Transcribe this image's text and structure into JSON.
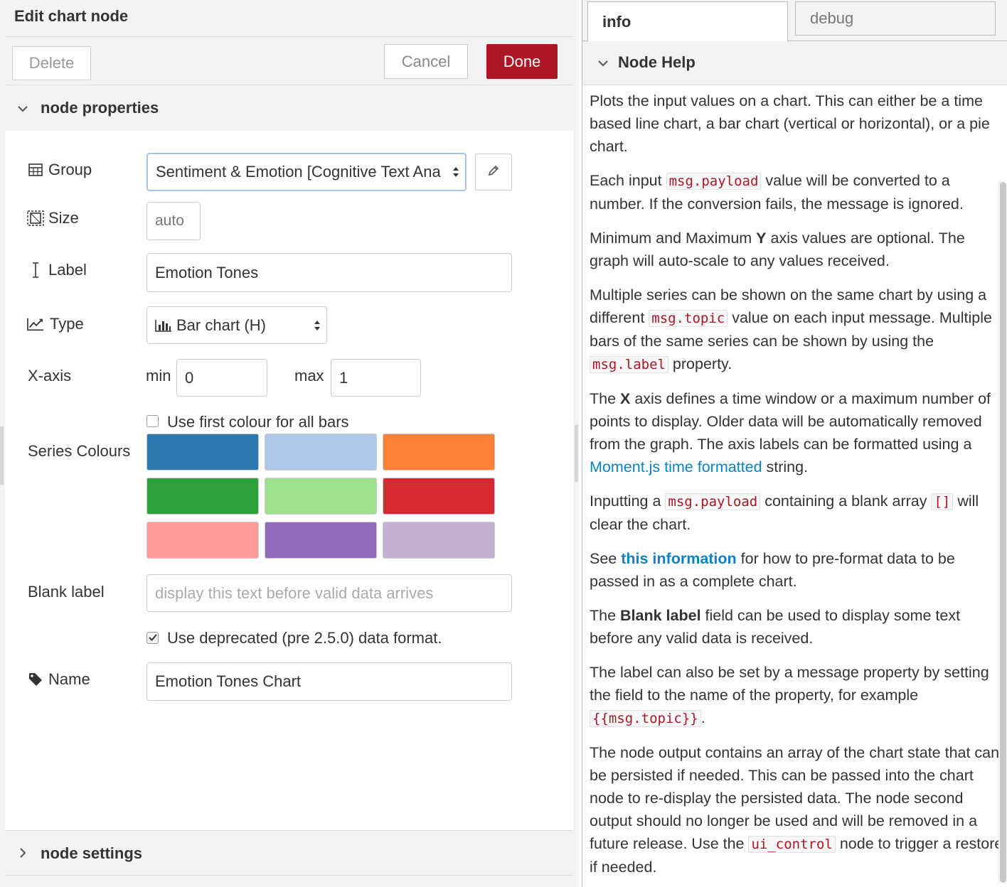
{
  "tray": {
    "title": "Edit chart node",
    "delete_label": "Delete",
    "cancel_label": "Cancel",
    "done_label": "Done"
  },
  "sections": {
    "properties_title": "node properties",
    "settings_title": "node settings"
  },
  "form": {
    "group_label": "Group",
    "group_value": "Sentiment & Emotion [Cognitive Text Ana",
    "size_label": "Size",
    "size_value": "auto",
    "label_label": "Label",
    "label_value": "Emotion Tones",
    "type_label": "Type",
    "type_value": "Bar chart (H)",
    "xaxis_label": "X-axis",
    "min_label": "min",
    "min_value": "0",
    "max_label": "max",
    "max_value": "1",
    "first_colour_label": "Use first colour for all bars",
    "first_colour_checked": false,
    "series_colours_label": "Series Colours",
    "colours": [
      "#2e78b0",
      "#aec7e8",
      "#fc8035",
      "#2ea13a",
      "#9fe08c",
      "#d62830",
      "#ff9b9b",
      "#9369b9",
      "#c5b0d4"
    ],
    "blank_label_label": "Blank label",
    "blank_label_placeholder": "display this text before valid data arrives",
    "deprecated_label": "Use deprecated (pre 2.5.0) data format.",
    "deprecated_checked": true,
    "name_label": "Name",
    "name_value": "Emotion Tones Chart"
  },
  "sidebar": {
    "tab_info": "info",
    "tab_debug": "debug",
    "help_title": "Node Help",
    "help": {
      "p1": "Plots the input values on a chart. This can either be a time based line chart, a bar chart (vertical or horizontal), or a pie chart.",
      "p2_a": "Each input ",
      "p2_code": "msg.payload",
      "p2_b": " value will be converted to a number. If the conversion fails, the message is ignored.",
      "p3_a": "Minimum and Maximum ",
      "p3_bold": "Y",
      "p3_b": " axis values are optional. The graph will auto-scale to any values received.",
      "p4_a": "Multiple series can be shown on the same chart by using a different ",
      "p4_code1": "msg.topic",
      "p4_b": " value on each input message. Multiple bars of the same series can be shown by using the ",
      "p4_code2": "msg.label",
      "p4_c": " property.",
      "p5_a": "The ",
      "p5_bold": "X",
      "p5_b": " axis defines a time window or a maximum number of points to display. Older data will be automatically removed from the graph. The axis labels can be formatted using a ",
      "p5_link": "Moment.js time formatted",
      "p5_c": " string.",
      "p6_a": "Inputting a ",
      "p6_code1": "msg.payload",
      "p6_b": " containing a blank array ",
      "p6_code2": "[]",
      "p6_c": " will clear the chart.",
      "p7_a": "See ",
      "p7_link": "this information",
      "p7_b": " for how to pre-format data to be passed in as a complete chart.",
      "p8_a": "The ",
      "p8_bold": "Blank label",
      "p8_b": " field can be used to display some text before any valid data is received.",
      "p9_a": "The label can also be set by a message property by setting the field to the name of the property, for example ",
      "p9_code": "{{msg.topic}}",
      "p9_b": ".",
      "p10_a": "The node output contains an array of the chart state that can be persisted if needed. This can be passed into the chart node to re-display the persisted data. The node second output should no longer be used and will be removed in a future release. Use the ",
      "p10_code": "ui_control",
      "p10_b": " node to trigger a restore if needed."
    }
  }
}
